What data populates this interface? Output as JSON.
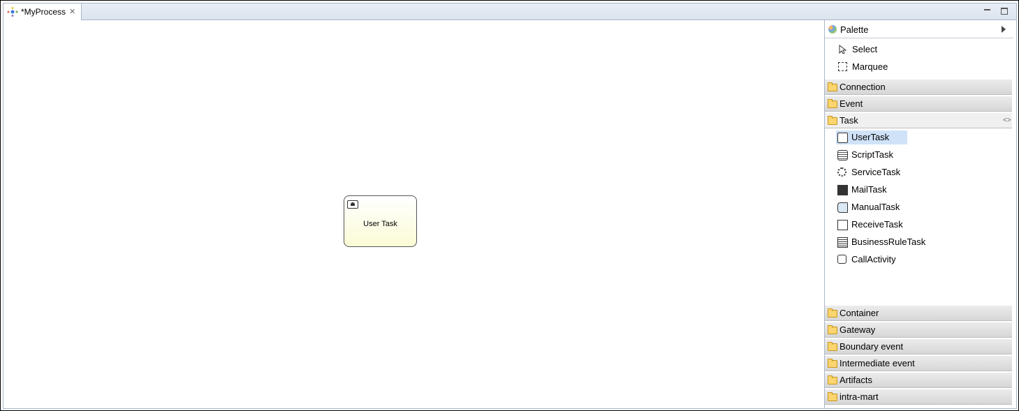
{
  "tab": {
    "title": "*MyProcess",
    "icon": "process-icon",
    "close_icon": "close-icon"
  },
  "window": {
    "minimize_icon": "minimize-icon",
    "maximize_icon": "maximize-icon"
  },
  "canvas": {
    "nodes": [
      {
        "label": "User Task",
        "type": "user-task"
      }
    ]
  },
  "palette": {
    "title": "Palette",
    "tools": [
      {
        "label": "Select",
        "icon": "arrow-pointer-icon"
      },
      {
        "label": "Marquee",
        "icon": "marquee-icon"
      }
    ],
    "drawers": [
      {
        "label": "Connection",
        "open": false
      },
      {
        "label": "Event",
        "open": false
      },
      {
        "label": "Task",
        "open": true,
        "items": [
          {
            "label": "UserTask",
            "icon": "user-task-icon",
            "selected": true
          },
          {
            "label": "ScriptTask",
            "icon": "script-task-icon"
          },
          {
            "label": "ServiceTask",
            "icon": "service-task-icon"
          },
          {
            "label": "MailTask",
            "icon": "mail-task-icon"
          },
          {
            "label": "ManualTask",
            "icon": "manual-task-icon"
          },
          {
            "label": "ReceiveTask",
            "icon": "receive-task-icon"
          },
          {
            "label": "BusinessRuleTask",
            "icon": "business-rule-task-icon"
          },
          {
            "label": "CallActivity",
            "icon": "call-activity-icon"
          }
        ]
      },
      {
        "label": "Container",
        "open": false
      },
      {
        "label": "Gateway",
        "open": false
      },
      {
        "label": "Boundary event",
        "open": false
      },
      {
        "label": "Intermediate event",
        "open": false
      },
      {
        "label": "Artifacts",
        "open": false
      },
      {
        "label": "intra-mart",
        "open": false
      }
    ]
  }
}
